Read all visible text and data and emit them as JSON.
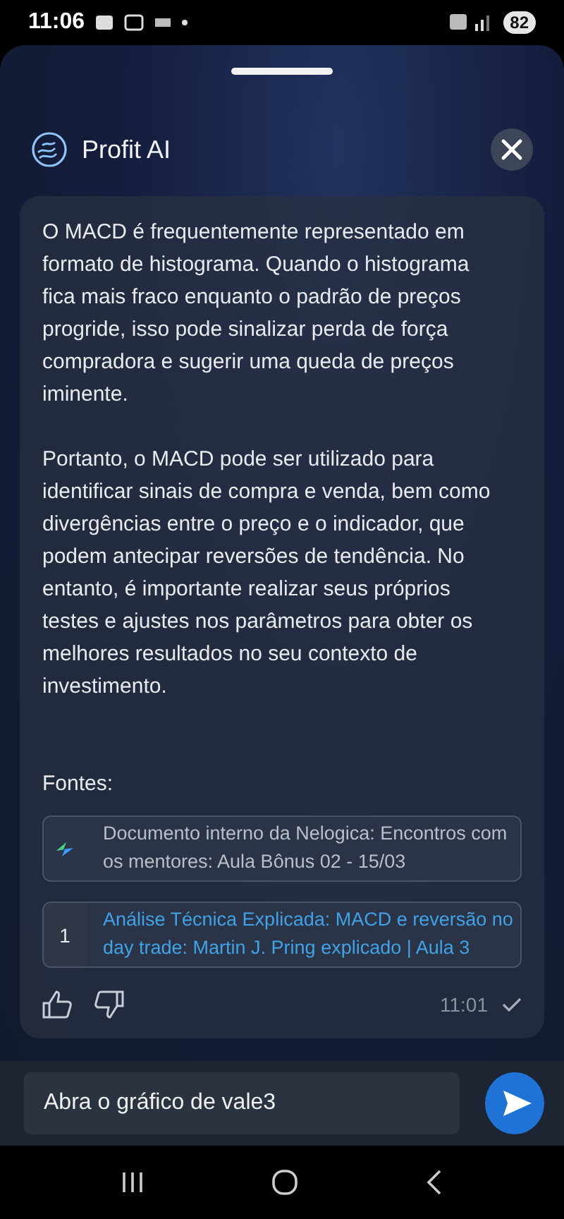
{
  "status_bar": {
    "time": "11:06",
    "battery": "82"
  },
  "header": {
    "title": "Profit AI"
  },
  "message": {
    "paragraphs": [
      "O MACD é frequentemente representado em formato de histograma. Quando o histograma fica mais fraco enquanto o padrão de preços progride, isso pode sinalizar perda de força compradora e sugerir uma queda de preços iminente.",
      "Portanto, o MACD pode ser utilizado para identificar sinais de compra e venda, bem como divergências entre o preço e o indicador, que podem antecipar reversões de tendência. No entanto, é importante realizar seus próprios testes e ajustes nos parâmetros para obter os melhores resultados no seu contexto de investimento."
    ],
    "sources_label": "Fontes:",
    "sources": [
      {
        "kind": "document",
        "title": "Documento interno da Nelogica: Encontros com os mentores: Aula Bônus 02 - 15/03"
      },
      {
        "kind": "video",
        "number": "1",
        "title": "Análise Técnica Explicada: MACD e reversão no day trade: Martin J. Pring explicado | Aula 3"
      }
    ],
    "time": "11:01"
  },
  "composer": {
    "value": "Abra o gráfico de vale3"
  }
}
